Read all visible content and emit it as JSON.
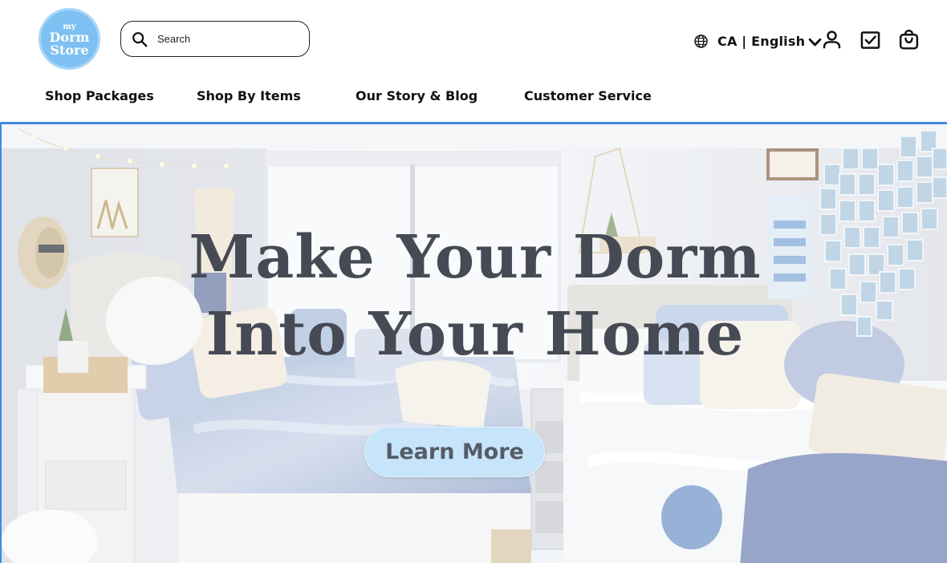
{
  "logo": {
    "line1": "my",
    "line2": "Dorm",
    "line3": "Store"
  },
  "search": {
    "placeholder": "Search"
  },
  "locale": {
    "label": "CA | English"
  },
  "header_icons": [
    "globe-icon",
    "account-icon",
    "checklist-icon",
    "cart-icon"
  ],
  "nav": {
    "items": [
      {
        "label": "Shop Packages"
      },
      {
        "label": "Shop By Items"
      },
      {
        "label": "Our Story & Blog"
      },
      {
        "label": "Customer Service"
      }
    ]
  },
  "hero": {
    "title_line1": "Make Your Dorm",
    "title_line2": "Into Your Home",
    "cta_label": "Learn More"
  },
  "colors": {
    "accent_blue": "#3d8be0",
    "logo_blue": "#7ec0f2",
    "cta_bg": "#c6e4fa",
    "hero_text": "#464a54"
  }
}
